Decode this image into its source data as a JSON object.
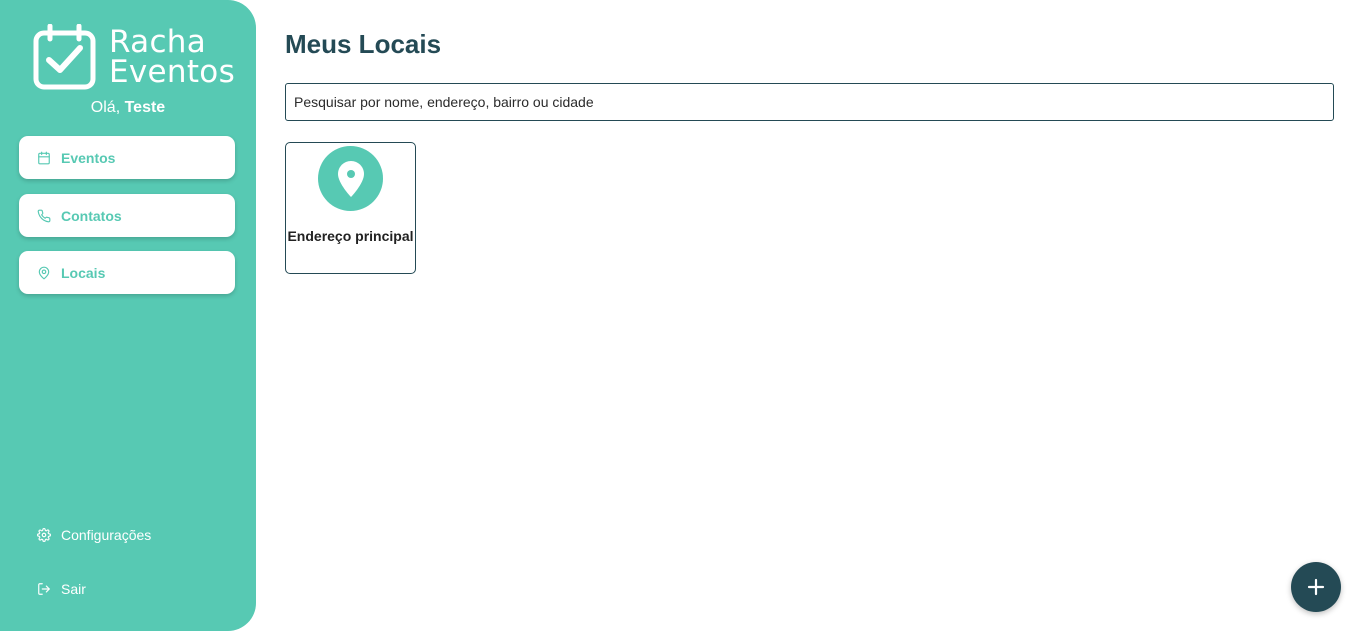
{
  "brand": {
    "logo_line1": "Racha",
    "logo_line2": "Eventos",
    "accent_color": "#57c9b3",
    "dark_color": "#244a55"
  },
  "greeting": {
    "prefix": "Olá,",
    "user": "Teste"
  },
  "nav": {
    "items": [
      {
        "label": "Eventos",
        "icon": "calendar-icon"
      },
      {
        "label": "Contatos",
        "icon": "phone-icon"
      },
      {
        "label": "Locais",
        "icon": "map-pin-icon"
      }
    ]
  },
  "bottom_nav": {
    "settings_label": "Configurações",
    "settings_icon": "gear-icon",
    "logout_label": "Sair",
    "logout_icon": "logout-icon"
  },
  "main": {
    "title": "Meus Locais",
    "search_placeholder": "Pesquisar por nome, endereço, bairro ou cidade",
    "search_value": "",
    "locations": [
      {
        "name": "Endereço principal",
        "icon": "map-pin-icon"
      }
    ]
  },
  "fab": {
    "icon": "plus-icon"
  }
}
